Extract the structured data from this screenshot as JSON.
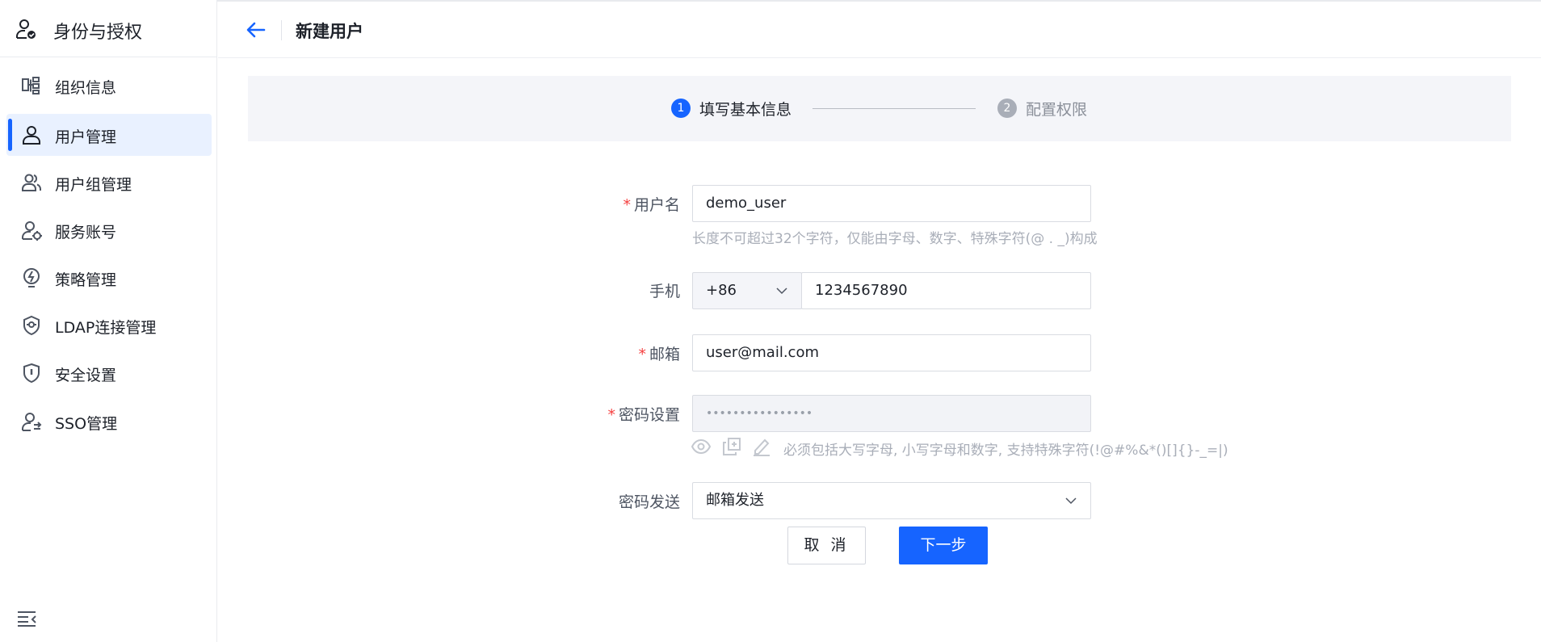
{
  "sidebar": {
    "title": "身份与授权",
    "items": [
      {
        "label": "组织信息",
        "icon": "org-icon",
        "active": false
      },
      {
        "label": "用户管理",
        "icon": "user-icon",
        "active": true
      },
      {
        "label": "用户组管理",
        "icon": "user-group-icon",
        "active": false
      },
      {
        "label": "服务账号",
        "icon": "service-account-icon",
        "active": false
      },
      {
        "label": "策略管理",
        "icon": "policy-icon",
        "active": false
      },
      {
        "label": "LDAP连接管理",
        "icon": "ldap-icon",
        "active": false
      },
      {
        "label": "安全设置",
        "icon": "shield-icon",
        "active": false
      },
      {
        "label": "SSO管理",
        "icon": "sso-icon",
        "active": false
      }
    ]
  },
  "header": {
    "title": "新建用户"
  },
  "steps": [
    {
      "number": "1",
      "label": "填写基本信息",
      "status": "current"
    },
    {
      "number": "2",
      "label": "配置权限",
      "status": "pending"
    }
  ],
  "form": {
    "username": {
      "required_mark": "*",
      "label": "用户名",
      "value": "demo_user",
      "hint": "长度不可超过32个字符，仅能由字母、数字、特殊字符(@ . _)构成"
    },
    "phone": {
      "label": "手机",
      "country_code": "+86",
      "value": "1234567890"
    },
    "email": {
      "required_mark": "*",
      "label": "邮箱",
      "value": "user@mail.com"
    },
    "password": {
      "required_mark": "*",
      "label": "密码设置",
      "value": "••••••••••••••••",
      "hint": "必须包括大写字母, 小写字母和数字, 支持特殊字符(!@#%&*()[]{}-_=|)"
    },
    "password_delivery": {
      "label": "密码发送",
      "value": "邮箱发送"
    }
  },
  "buttons": {
    "cancel": "取 消",
    "next": "下一步"
  },
  "colors": {
    "primary": "#1664ff",
    "required": "#f53f3f",
    "active_bg": "#e9f1ff"
  }
}
